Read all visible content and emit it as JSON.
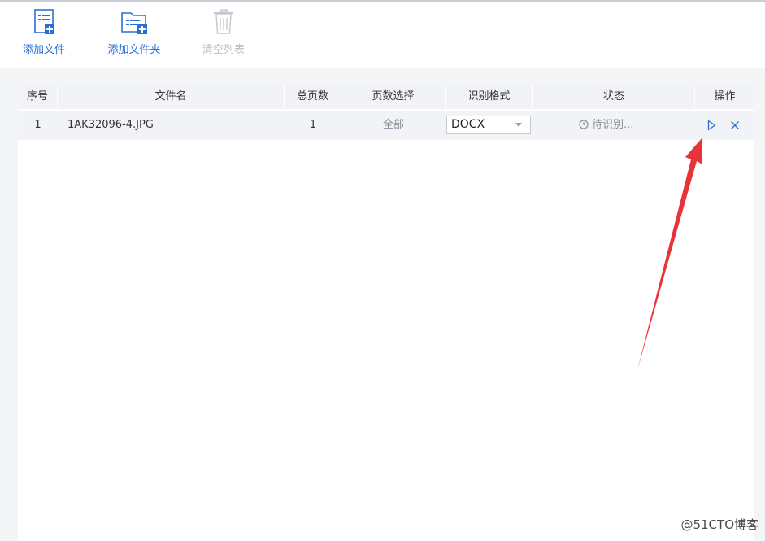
{
  "toolbar": {
    "add_file": "添加文件",
    "add_folder": "添加文件夹",
    "clear_list": "清空列表"
  },
  "table": {
    "columns": [
      "序号",
      "文件名",
      "总页数",
      "页数选择",
      "识别格式",
      "状态",
      "操作"
    ],
    "rows": [
      {
        "index": "1",
        "filename": "1AK32096-4.JPG",
        "total_pages": "1",
        "page_selection": "全部",
        "format": "DOCX",
        "status": "待识别..."
      }
    ]
  },
  "colors": {
    "accent": "#2b6fd6",
    "annotation_arrow": "#e8333a"
  },
  "watermark": "@51CTO博客"
}
